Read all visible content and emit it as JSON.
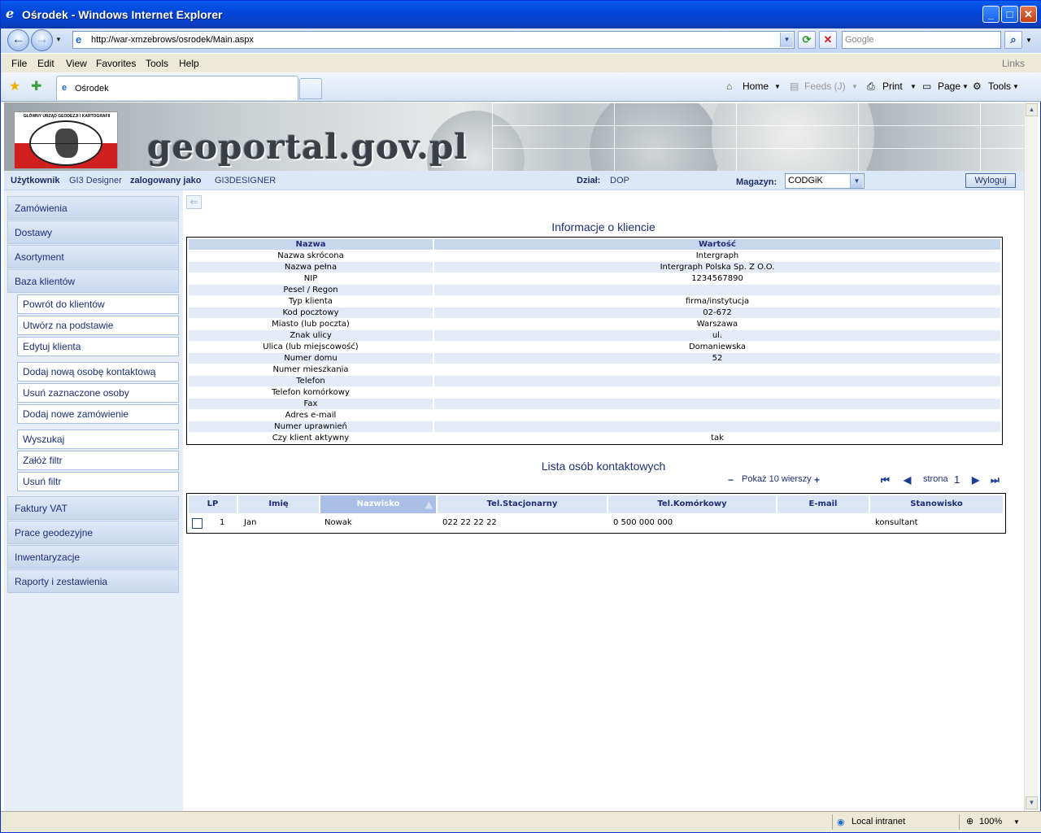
{
  "window": {
    "title": "Ośrodek - Windows Internet Explorer"
  },
  "nav": {
    "url": "http://war-xmzebrows/osrodek/Main.aspx",
    "search_placeholder": "Google"
  },
  "menu": [
    "File",
    "Edit",
    "View",
    "Favorites",
    "Tools",
    "Help"
  ],
  "menu_links": "Links",
  "tab": {
    "title": "Ośrodek"
  },
  "commands": {
    "home": "Home",
    "feeds": "Feeds (J)",
    "print": "Print",
    "page": "Page",
    "tools": "Tools"
  },
  "banner": {
    "site_name": "geoportal.gov.pl",
    "logo_text": "GŁÓWNY URZĄD GEODEZJI I KARTOGRAFII"
  },
  "userbar": {
    "user_label": "Użytkownik",
    "user_value": "GI3 Designer",
    "logged_label": "zalogowany jako",
    "logged_value": "GI3DESIGNER",
    "dept_label": "Dział:",
    "dept_value": "DOP",
    "store_label": "Magazyn:",
    "store_value": "CODGiK",
    "logout": "Wyloguj"
  },
  "sidebar": {
    "top": [
      "Zamówienia",
      "Dostawy",
      "Asortyment",
      "Baza klientów"
    ],
    "sub1": [
      "Powrót do klientów",
      "Utwórz na podstawie",
      "Edytuj klienta"
    ],
    "sub2": [
      "Dodaj nową osobę kontaktową",
      "Usuń zaznaczone osoby",
      "Dodaj nowe zamówienie"
    ],
    "sub3": [
      "Wyszukaj",
      "Załóż filtr",
      "Usuń filtr"
    ],
    "bottom": [
      "Faktury VAT",
      "Prace geodezyjne",
      "Inwentaryzacje",
      "Raporty i zestawienia"
    ]
  },
  "info": {
    "title": "Informacje o kliencie",
    "headers": [
      "Nazwa",
      "Wartość"
    ],
    "rows": [
      [
        "Nazwa skrócona",
        "Intergraph"
      ],
      [
        "Nazwa pełna",
        "Intergraph Polska Sp. Z O.O."
      ],
      [
        "NIP",
        "1234567890"
      ],
      [
        "Pesel / Regon",
        ""
      ],
      [
        "Typ klienta",
        "firma/instytucja"
      ],
      [
        "Kod pocztowy",
        "02-672"
      ],
      [
        "Miasto (lub poczta)",
        "Warszawa"
      ],
      [
        "Znak ulicy",
        "ul."
      ],
      [
        "Ulica (lub miejscowość)",
        "Domaniewska"
      ],
      [
        "Numer domu",
        "52"
      ],
      [
        "Numer mieszkania",
        ""
      ],
      [
        "Telefon",
        ""
      ],
      [
        "Telefon komórkowy",
        ""
      ],
      [
        "Fax",
        ""
      ],
      [
        "Adres e-mail",
        ""
      ],
      [
        "Numer uprawnień",
        ""
      ],
      [
        "Czy klient aktywny",
        "tak"
      ]
    ]
  },
  "contacts": {
    "title": "Lista osób kontaktowych",
    "rows_label": "Pokaż 10 wierszy",
    "page_label": "strona",
    "page_num": "1",
    "headers": [
      "LP",
      "Imię",
      "Nazwisko",
      "Tel.Stacjonarny",
      "Tel.Komórkowy",
      "E-mail",
      "Stanowisko"
    ],
    "rows": [
      [
        "1",
        "Jan",
        "Nowak",
        "022 22 22 22",
        "0 500 000 000",
        "",
        "konsultant"
      ]
    ]
  },
  "status": {
    "zone": "Local intranet",
    "zoom": "100%"
  }
}
